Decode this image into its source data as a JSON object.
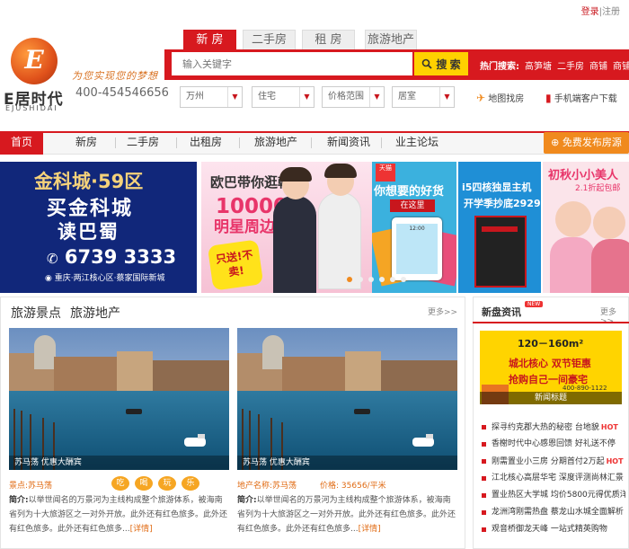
{
  "header": {
    "login": "登录",
    "register": "注册",
    "logo_letter": "E",
    "logo_cn": "E居时代",
    "logo_en": "EJUSHIDAI",
    "slogan": "为您实现您的梦想",
    "phone": "400-454546656"
  },
  "search": {
    "tabs": [
      "新 房",
      "二手房",
      "租 房",
      "旅游地产"
    ],
    "placeholder": "输入关键字",
    "button": "搜 索",
    "hot_label": "热门搜索:",
    "hot_items": [
      "高笋塘",
      "二手房",
      "商铺",
      "商铺"
    ],
    "filters": [
      "万州",
      "住宅",
      "价格范围",
      "居室"
    ],
    "map_search": "地图找房",
    "mobile_app": "手机端客户下载"
  },
  "nav": {
    "home": "首页",
    "items": [
      "新房",
      "二手房",
      "出租房",
      "旅游地产",
      "新闻资讯",
      "业主论坛"
    ],
    "publish": "免费发布房源"
  },
  "banners": {
    "b1": {
      "title": "金科城·59区",
      "line2": "买金科城",
      "line3": "读巴蜀",
      "phone": "6739 3333",
      "address": "重庆·两江核心区·蔡家国际新城"
    },
    "b2": {
      "title": "欧巴带你逛韩国",
      "line2": "10000件",
      "line3": "明星周边",
      "burst": "只送!不卖!"
    },
    "b3": {
      "badge": "天猫",
      "title": "你想要的好货",
      "sub": "在这里",
      "tablet_time": "12:00"
    },
    "b4": {
      "title": "i5四核独显主机",
      "sub": "开学季抄底2929"
    },
    "b5": {
      "title": "初秋小小美人",
      "sub": "2.1折起包邮"
    },
    "slide_count": 6,
    "active_slide": 0
  },
  "tourism": {
    "section_title_1": "旅游景点",
    "section_title_2": "旅游地产",
    "more": "更多>>",
    "cards": [
      {
        "caption": "苏马荡 优惠大酬宾",
        "location_label": "景点:",
        "location": "苏马荡",
        "tags": [
          "吃",
          "喝",
          "玩",
          "乐"
        ],
        "intro_label": "简介:",
        "intro": "以举世闻名的万景河为主线构成整个旅游体系，被海南省列为十大旅游区之一对外开放。此外还有红色旅多。此外还有红色旅多。此外还有红色旅多...",
        "detail": "[详情]"
      },
      {
        "caption": "苏马荡 优惠大酬宾",
        "location_label": "地产名称:",
        "location": "苏马荡",
        "price_label": "价格:",
        "price": "35656/平米",
        "intro_label": "简介:",
        "intro": "以举世闻名的万景河为主线构成整个旅游体系，被海南省列为十大旅游区之一对外开放。此外还有红色旅多。此外还有红色旅多。此外还有红色旅多...",
        "detail": "[详情]"
      }
    ]
  },
  "news": {
    "title": "新盘资讯",
    "badge": "NEW",
    "more": "更多>>",
    "banner": {
      "area": "120－160m²",
      "line1": "城北核心 双节钜惠",
      "line2": "抢购自己一间豪宅",
      "phone": "400-890-1122",
      "caption": "新闻标题"
    },
    "items": [
      {
        "text": "探寻约克郡大热的秘密 台地貌",
        "hot": "HOT"
      },
      {
        "text": "香榭时代中心感恩回馈 好礼送不停",
        "hot": ""
      },
      {
        "text": "刚需置业小三房 分期首付2万起",
        "hot": "HOT"
      },
      {
        "text": "江北核心高层华宅 深度评测尚林汇景",
        "hot": ""
      },
      {
        "text": "置业热区大学城 均价5800元得优质洋",
        "hot": ""
      },
      {
        "text": "龙洲湾刚需热盘 蔡龙山水城全面解析",
        "hot": ""
      },
      {
        "text": "观音桥御龙天峰 一站式精英购物",
        "hot": ""
      }
    ]
  }
}
